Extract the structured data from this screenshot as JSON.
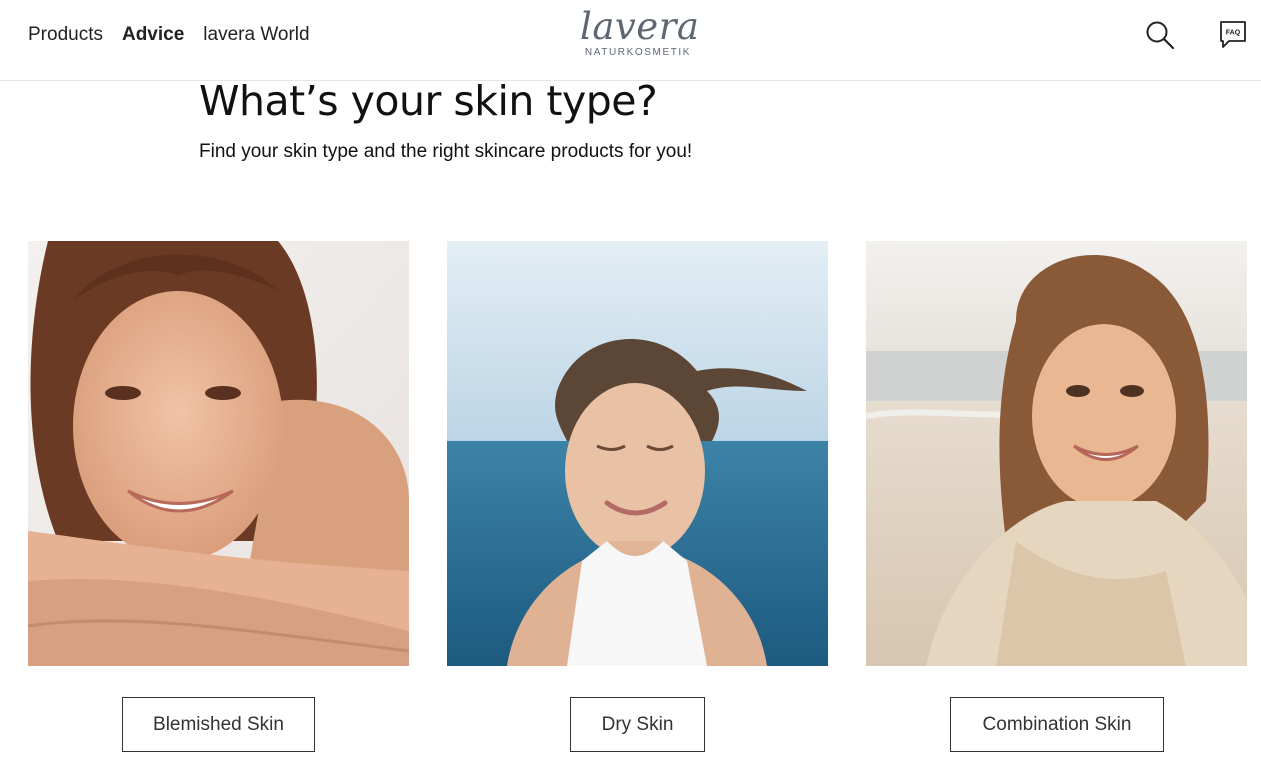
{
  "nav": {
    "items": [
      {
        "label": "Products",
        "active": false
      },
      {
        "label": "Advice",
        "active": true
      },
      {
        "label": "lavera World",
        "active": false
      }
    ]
  },
  "logo": {
    "word": "lavera",
    "sub": "NATURKOSMETIK",
    "color": "#5e6771"
  },
  "header_icons": {
    "search": "search-icon",
    "faq": "faq-icon",
    "faq_label": "FAQ"
  },
  "hero": {
    "title": "What’s your skin type?",
    "subtitle": "Find your skin type and the right skincare products for you!"
  },
  "skin_types": [
    {
      "button_label": "Blemished Skin",
      "image": "woman-smiling-resting-chin-on-arms"
    },
    {
      "button_label": "Dry Skin",
      "image": "woman-at-sea-wind-in-hair"
    },
    {
      "button_label": "Combination Skin",
      "image": "woman-on-beach-in-knit-sweater"
    }
  ]
}
